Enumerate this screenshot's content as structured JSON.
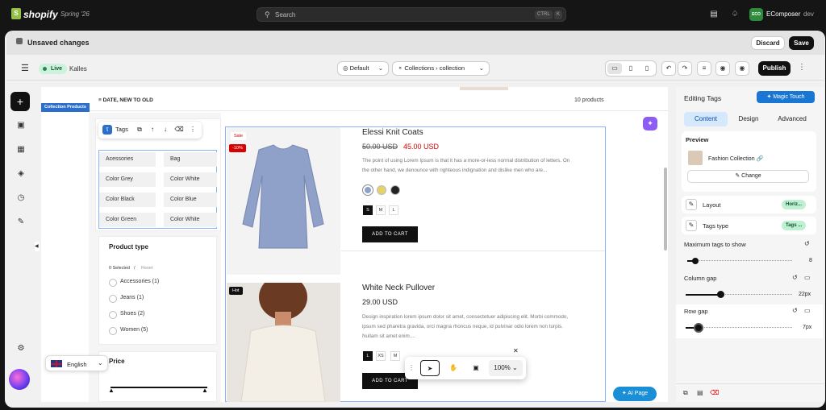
{
  "topbar": {
    "brand": "shopify",
    "edition": "Spring '26",
    "search_placeholder": "Search",
    "shortcut_ctrl": "CTRL",
    "shortcut_k": "K",
    "store_badge": "ECO",
    "store_name": "EComposer",
    "store_env": "dev"
  },
  "unsaved": {
    "text": "Unsaved changes",
    "discard": "Discard",
    "save": "Save"
  },
  "editor_toolbar": {
    "live_badge": "Live",
    "theme_name": "Kalles",
    "market_select": "Default",
    "template_prefix": "Collections",
    "template_name": "collection",
    "publish": "Publish"
  },
  "canvas": {
    "sort_label": "DATE, NEW TO OLD",
    "product_count": "10 products",
    "section_tag": "Collection Products",
    "tags_toolbar_label": "Tags",
    "tags": [
      "Acessories",
      "Bag",
      "Color Grey",
      "Color White",
      "Color Black",
      "Color Blue",
      "Color Green",
      "Color White"
    ],
    "filter": {
      "title": "Product type",
      "selected": "0 Selected",
      "separator": "/",
      "reset": "Reset",
      "options": [
        "Accessories (1)",
        "Jeans (1)",
        "Shoes (2)",
        "Women (5)"
      ]
    },
    "price_title": "Price",
    "language": "English",
    "products": [
      {
        "badge_top": "Sale",
        "badge_discount": "-10%",
        "title": "Elessi Knit Coats",
        "old_price": "50.00 USD",
        "price": "45.00 USD",
        "description_line1": "The point of using Lorem Ipsum is that it has a more-or-less normal distribution of letters. On",
        "description_line2": "the other hand, we denounce with righteous indignation and dislike men who are...",
        "sizes": [
          "S",
          "M",
          "L"
        ],
        "cta": "ADD TO CART"
      },
      {
        "badge_top": "Hot",
        "title": "White Neck Pullover",
        "price": "29.00 USD",
        "description_line1": "Design inspiration lorem ipsum dolor sit amet, consectetuer adipiscing elit. Morbi commodo,",
        "description_line2": "ipsum sed pharetra gravida, orci magna rhoncus neque, id pulvinar odio lorem non turpis.",
        "description_line3": "Nullam sit amet enim....",
        "sizes": [
          "L",
          "XS",
          "M"
        ],
        "cta": "ADD TO CART"
      }
    ],
    "zoom": "100%",
    "ai_page": "AI Page"
  },
  "right_panel": {
    "title": "Editing Tags",
    "magic_touch": "Magic Touch",
    "tabs": [
      "Content",
      "Design",
      "Advanced"
    ],
    "preview_label": "Preview",
    "preview_name": "Fashion Collection",
    "change": "Change",
    "layout_label": "Layout",
    "layout_value": "Horiz...",
    "tags_type_label": "Tags type",
    "tags_type_value": "Tags ...",
    "max_tags_label": "Maximum tags to show",
    "max_tags_value": "8",
    "max_tags_fraction": 0.08,
    "column_gap_label": "Column gap",
    "column_gap_value": "22px",
    "column_gap_fraction": 0.33,
    "row_gap_label": "Row gap",
    "row_gap_value": "7px",
    "row_gap_fraction": 0.12
  },
  "colors": {
    "accent_blue": "#1976d2",
    "live_green": "#29845a",
    "sale_red": "#d60000",
    "ai_purple": "#8c5cf5"
  }
}
